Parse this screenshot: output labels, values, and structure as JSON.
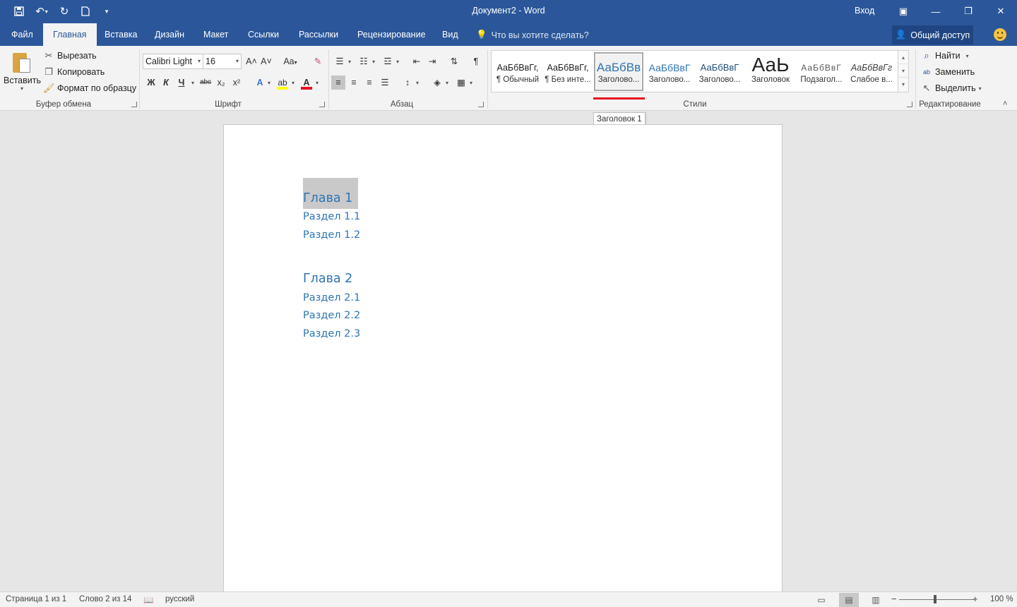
{
  "window": {
    "title": "Документ2  -  Word",
    "signin": "Вход",
    "minimize_glyph": "—",
    "restore_glyph": "❐",
    "close_glyph": "✕",
    "ribbon_display_glyph": "▣"
  },
  "qat": {
    "save_icon": "save-icon",
    "undo_icon": "undo-icon",
    "redo_icon": "redo-icon",
    "new_icon": "new-document-icon",
    "customize_icon": "customize-qat-icon"
  },
  "tabs": [
    {
      "label": "Файл"
    },
    {
      "label": "Главная",
      "active": true
    },
    {
      "label": "Вставка"
    },
    {
      "label": "Дизайн"
    },
    {
      "label": "Макет"
    },
    {
      "label": "Ссылки"
    },
    {
      "label": "Рассылки"
    },
    {
      "label": "Рецензирование"
    },
    {
      "label": "Вид"
    }
  ],
  "tellme": "Что вы хотите сделать?",
  "share": "Общий доступ",
  "clipboard": {
    "paste": "Вставить",
    "cut": "Вырезать",
    "copy": "Копировать",
    "format_painter": "Формат по образцу",
    "group": "Буфер обмена"
  },
  "font": {
    "family": "Calibri Light",
    "size": "16",
    "group": "Шрифт",
    "bold": "Ж",
    "italic": "К",
    "underline": "Ч",
    "strike": "abc",
    "subscript": "x₂",
    "superscript": "x²",
    "grow": "A˄",
    "shrink": "A˅",
    "case": "Aa",
    "font_color_hex": "#e81123",
    "highlight_hex": "#ffff00"
  },
  "paragraph": {
    "group": "Абзац",
    "pilcrow": "¶"
  },
  "styles": {
    "group": "Стили",
    "items": [
      {
        "sample": "АаБбВвГг,",
        "name": "¶ Обычный"
      },
      {
        "sample": "АаБбВвГг,",
        "name": "¶ Без инте..."
      },
      {
        "sample": "АаБбВв",
        "name": "Заголово...",
        "selected": true
      },
      {
        "sample": "АаБбВвГ",
        "name": "Заголово..."
      },
      {
        "sample": "АаБбВвГ",
        "name": "Заголово..."
      },
      {
        "sample": "АаЬ",
        "name": "Заголовок"
      },
      {
        "sample": "АаБбВвГ",
        "name": "Подзагол..."
      },
      {
        "sample": "АаБбВвГг",
        "name": "Слабое в..."
      }
    ],
    "tooltip": "Заголовок 1",
    "accent_hex": "#2e74b5",
    "marker_hex": "#e81123"
  },
  "editing": {
    "group": "Редактирование",
    "find": "Найти",
    "replace": "Заменить",
    "select": "Выделить"
  },
  "document": {
    "lines": [
      {
        "text": "Глава 1",
        "style": "h1",
        "selected": true
      },
      {
        "text": "Раздел 1.1",
        "style": "h2"
      },
      {
        "text": "Раздел 1.2",
        "style": "h2"
      },
      {
        "text": "Глава 2",
        "style": "h1"
      },
      {
        "text": "Раздел 2.1",
        "style": "h2"
      },
      {
        "text": "Раздел 2.2",
        "style": "h2"
      },
      {
        "text": "Раздел 2.3",
        "style": "h2"
      }
    ]
  },
  "status": {
    "page": "Страница 1 из 1",
    "words": "Слово 2 из 14",
    "language": "русский",
    "zoom": "100 %",
    "zoom_percent": 100,
    "view": "print-layout"
  }
}
